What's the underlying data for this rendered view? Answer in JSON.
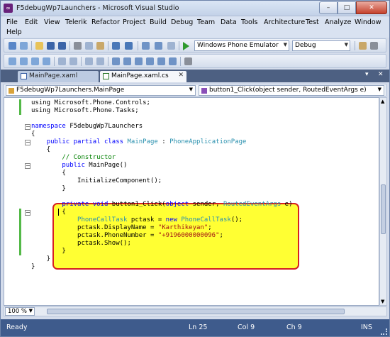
{
  "window": {
    "title": "F5debugWp7Launchers - Microsoft Visual Studio",
    "min_glyph": "–",
    "max_glyph": "□",
    "close_glyph": "✕"
  },
  "menu": {
    "items": [
      "File",
      "Edit",
      "View",
      "Telerik",
      "Refactor",
      "Project",
      "Build",
      "Debug",
      "Team",
      "Data",
      "Tools",
      "Architecture",
      "Test",
      "Analyze",
      "Window",
      "Help"
    ]
  },
  "toolbar": {
    "emulator_target": "Windows Phone Emulator",
    "configuration": "Debug"
  },
  "tabs": [
    {
      "label": "MainPage.xaml",
      "active": false
    },
    {
      "label": "MainPage.xaml.cs",
      "active": true
    }
  ],
  "navbar": {
    "class_selector": "F5debugWp7Launchers.MainPage",
    "member_selector": "button1_Click(object sender, RoutedEventArgs e)"
  },
  "code": {
    "lines": [
      [
        {
          "c": "",
          "t": "using Microsoft.Phone.Controls;"
        }
      ],
      [
        {
          "c": "",
          "t": "using Microsoft.Phone.Tasks;"
        }
      ],
      [
        {
          "c": "",
          "t": ""
        }
      ],
      [
        {
          "c": "kw",
          "t": "namespace"
        },
        {
          "c": "",
          "t": " F5debugWp7Launchers"
        }
      ],
      [
        {
          "c": "",
          "t": "{"
        }
      ],
      [
        {
          "c": "",
          "t": "    "
        },
        {
          "c": "kw",
          "t": "public partial class"
        },
        {
          "c": "",
          "t": " "
        },
        {
          "c": "ty",
          "t": "MainPage"
        },
        {
          "c": "",
          "t": " : "
        },
        {
          "c": "ty",
          "t": "PhoneApplicationPage"
        }
      ],
      [
        {
          "c": "",
          "t": "    {"
        }
      ],
      [
        {
          "c": "cm",
          "t": "        // Constructor"
        }
      ],
      [
        {
          "c": "",
          "t": "        "
        },
        {
          "c": "kw",
          "t": "public"
        },
        {
          "c": "",
          "t": " MainPage()"
        }
      ],
      [
        {
          "c": "",
          "t": "        {"
        }
      ],
      [
        {
          "c": "",
          "t": "            InitializeComponent();"
        }
      ],
      [
        {
          "c": "",
          "t": "        }"
        }
      ],
      [
        {
          "c": "",
          "t": ""
        }
      ],
      [
        {
          "c": "",
          "t": "        "
        },
        {
          "c": "kw",
          "t": "private void"
        },
        {
          "c": "",
          "t": " button1_Click("
        },
        {
          "c": "kw",
          "t": "object"
        },
        {
          "c": "",
          "t": " sender, "
        },
        {
          "c": "ty",
          "t": "RoutedEventArgs"
        },
        {
          "c": "",
          "t": " e)"
        }
      ],
      [
        {
          "c": "",
          "t": "        {"
        }
      ],
      [
        {
          "c": "",
          "t": "            "
        },
        {
          "c": "ty",
          "t": "PhoneCallTask"
        },
        {
          "c": "",
          "t": " pctask = "
        },
        {
          "c": "kw",
          "t": "new"
        },
        {
          "c": "",
          "t": " "
        },
        {
          "c": "ty",
          "t": "PhoneCallTask"
        },
        {
          "c": "",
          "t": "();"
        }
      ],
      [
        {
          "c": "",
          "t": "            pctask.DisplayName = "
        },
        {
          "c": "st",
          "t": "\"Karthikeyan\""
        },
        {
          "c": "",
          "t": ";"
        }
      ],
      [
        {
          "c": "",
          "t": "            pctask.PhoneNumber = "
        },
        {
          "c": "st",
          "t": "\"+9196000000096\""
        },
        {
          "c": "",
          "t": ";"
        }
      ],
      [
        {
          "c": "",
          "t": "            pctask.Show();"
        }
      ],
      [
        {
          "c": "",
          "t": "        }"
        }
      ],
      [
        {
          "c": "",
          "t": "    }"
        }
      ],
      [
        {
          "c": "",
          "t": "}"
        }
      ]
    ]
  },
  "zoom": "100 %",
  "status": {
    "state": "Ready",
    "line": "Ln 25",
    "col": "Col 9",
    "ch": "Ch 9",
    "mode": "INS"
  }
}
